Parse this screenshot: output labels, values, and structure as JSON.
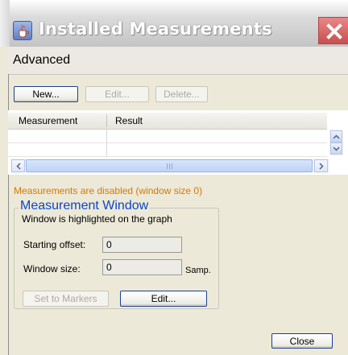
{
  "window": {
    "title": "Installed Measurements",
    "close_icon": "close-x-icon",
    "app_icon": "java-cup-icon"
  },
  "header": {
    "title": "Advanced"
  },
  "toolbar": {
    "new_label": "New...",
    "edit_label": "Edit...",
    "delete_label": "Delete..."
  },
  "table": {
    "columns": [
      "Measurement",
      "Result"
    ],
    "rows": []
  },
  "status": {
    "warning": "Measurements are disabled (window size 0)",
    "warning_color": "#d77800"
  },
  "measurement_window": {
    "title": "Measurement Window",
    "description": "Window is highlighted on the graph",
    "starting_offset_label": "Starting offset:",
    "starting_offset_value": "0",
    "window_size_label": "Window size:",
    "window_size_value": "0",
    "window_size_unit": "Samp.",
    "set_to_markers_label": "Set to Markers",
    "edit_label": "Edit..."
  },
  "footer": {
    "close_label": "Close"
  },
  "colors": {
    "accent": "#0b46c7",
    "close_button": "#d35a5a"
  }
}
